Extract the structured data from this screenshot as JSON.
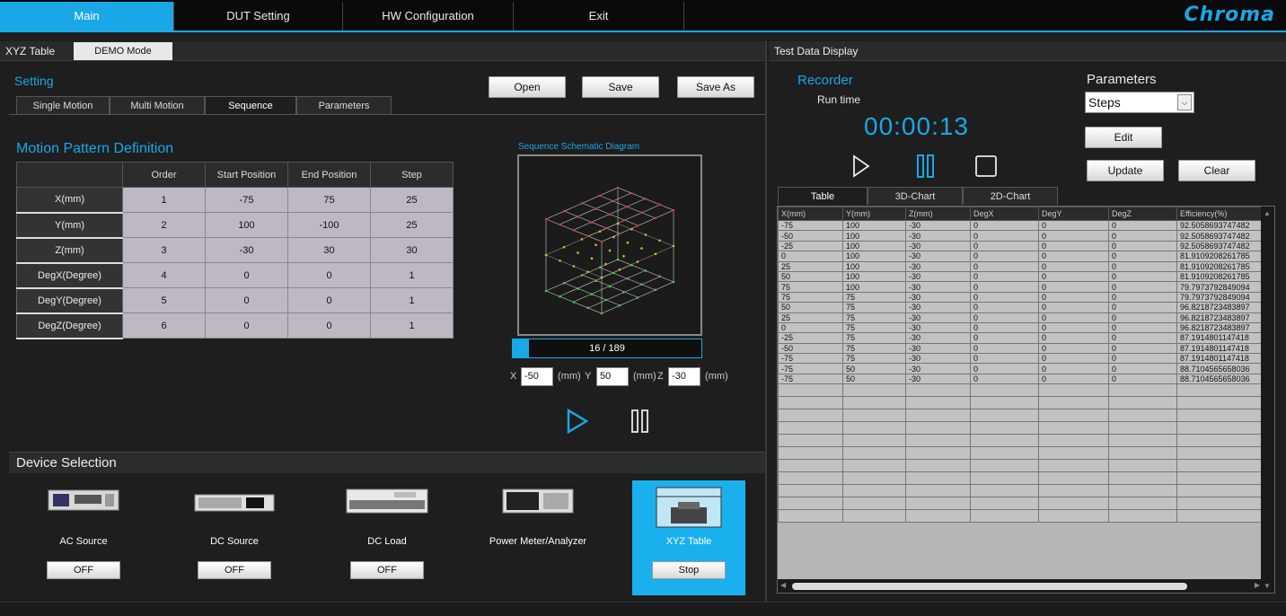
{
  "nav": {
    "tabs": [
      "Main",
      "DUT Setting",
      "HW Configuration",
      "Exit"
    ],
    "logo": "Chroma"
  },
  "left": {
    "tabs": [
      "XYZ Table",
      "DEMO Mode"
    ],
    "setting_title": "Setting",
    "subtabs": [
      "Single Motion",
      "Multi Motion",
      "Sequence",
      "Parameters"
    ],
    "buttons": {
      "open": "Open",
      "save": "Save",
      "save_as": "Save As"
    },
    "motion_title": "Motion Pattern Definition",
    "motion_headers": [
      "",
      "Order",
      "Start Position",
      "End Position",
      "Step"
    ],
    "motion_rows": [
      [
        "X(mm)",
        "1",
        "-75",
        "75",
        "25"
      ],
      [
        "Y(mm)",
        "2",
        "100",
        "-100",
        "25"
      ],
      [
        "Z(mm)",
        "3",
        "-30",
        "30",
        "30"
      ],
      [
        "DegX(Degree)",
        "4",
        "0",
        "0",
        "1"
      ],
      [
        "DegY(Degree)",
        "5",
        "0",
        "0",
        "1"
      ],
      [
        "DegZ(Degree)",
        "6",
        "0",
        "0",
        "1"
      ]
    ],
    "schematic_title": "Sequence Schematic Diagram",
    "progress": {
      "text": "16 / 189",
      "fraction": 0.085
    },
    "coords": {
      "x_label": "X",
      "x": "-50",
      "y_label": "Y",
      "y": "50",
      "z_label": "Z",
      "z": "-30",
      "unit": "(mm)"
    }
  },
  "devices": {
    "title": "Device Selection",
    "items": [
      {
        "name": "AC Source",
        "button": "OFF"
      },
      {
        "name": "DC Source",
        "button": "OFF"
      },
      {
        "name": "DC Load",
        "button": "OFF"
      },
      {
        "name": "Power Meter/Analyzer",
        "button": ""
      },
      {
        "name": "XYZ Table",
        "button": "Stop"
      }
    ]
  },
  "right": {
    "title": "Test Data Display",
    "recorder_title": "Recorder",
    "run_time_label": "Run time",
    "run_time": "00:00:13",
    "parameters_title": "Parameters",
    "parameters_value": "Steps",
    "buttons": {
      "edit": "Edit",
      "update": "Update",
      "clear": "Clear"
    },
    "data_tabs": [
      "Table",
      "3D-Chart",
      "2D-Chart"
    ],
    "grid_headers": [
      "X(mm)",
      "Y(mm)",
      "Z(mm)",
      "DegX",
      "DegY",
      "DegZ",
      "Efficiency(%)"
    ],
    "grid_rows": [
      [
        "-75",
        "100",
        "-30",
        "0",
        "0",
        "0",
        "92.5058693747482"
      ],
      [
        "-50",
        "100",
        "-30",
        "0",
        "0",
        "0",
        "92.5058693747482"
      ],
      [
        "-25",
        "100",
        "-30",
        "0",
        "0",
        "0",
        "92.5058693747482"
      ],
      [
        "0",
        "100",
        "-30",
        "0",
        "0",
        "0",
        "81.9109208261785"
      ],
      [
        "25",
        "100",
        "-30",
        "0",
        "0",
        "0",
        "81.9109208261785"
      ],
      [
        "50",
        "100",
        "-30",
        "0",
        "0",
        "0",
        "81.9109208261785"
      ],
      [
        "75",
        "100",
        "-30",
        "0",
        "0",
        "0",
        "79.7973792849094"
      ],
      [
        "75",
        "75",
        "-30",
        "0",
        "0",
        "0",
        "79.7973792849094"
      ],
      [
        "50",
        "75",
        "-30",
        "0",
        "0",
        "0",
        "96.8218723483897"
      ],
      [
        "25",
        "75",
        "-30",
        "0",
        "0",
        "0",
        "96.8218723483897"
      ],
      [
        "0",
        "75",
        "-30",
        "0",
        "0",
        "0",
        "96.8218723483897"
      ],
      [
        "-25",
        "75",
        "-30",
        "0",
        "0",
        "0",
        "87.1914801147418"
      ],
      [
        "-50",
        "75",
        "-30",
        "0",
        "0",
        "0",
        "87.1914801147418"
      ],
      [
        "-75",
        "75",
        "-30",
        "0",
        "0",
        "0",
        "87.1914801147418"
      ],
      [
        "-75",
        "50",
        "-30",
        "0",
        "0",
        "0",
        "88.7104565658036"
      ],
      [
        "-75",
        "50",
        "-30",
        "0",
        "0",
        "0",
        "88.7104565658036"
      ]
    ],
    "empty_rows": 11
  },
  "colors": {
    "accent": "#1aa7e8",
    "selected_device": "#1ab0ee"
  }
}
